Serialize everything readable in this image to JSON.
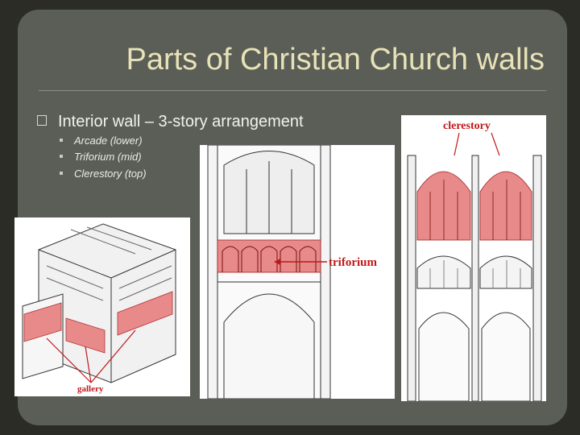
{
  "slide": {
    "title": "Parts of Christian Church walls",
    "main_bullet": {
      "marker_icon": "square-bullet-icon",
      "text": "Interior wall – 3-story arrangement"
    },
    "sub_bullets": [
      {
        "text": "Arcade (lower)"
      },
      {
        "text": "Triforium (mid)"
      },
      {
        "text": "Clerestory (top)"
      }
    ]
  },
  "images": {
    "gallery_label": "gallery",
    "triforium_label": "triforium",
    "clerestory_label": "clerestory"
  },
  "colors": {
    "background": "#2b2c26",
    "slide": "#5b5e57",
    "title": "#e8e2b8",
    "highlight": "#e88a8a",
    "label_red": "#c01818"
  }
}
